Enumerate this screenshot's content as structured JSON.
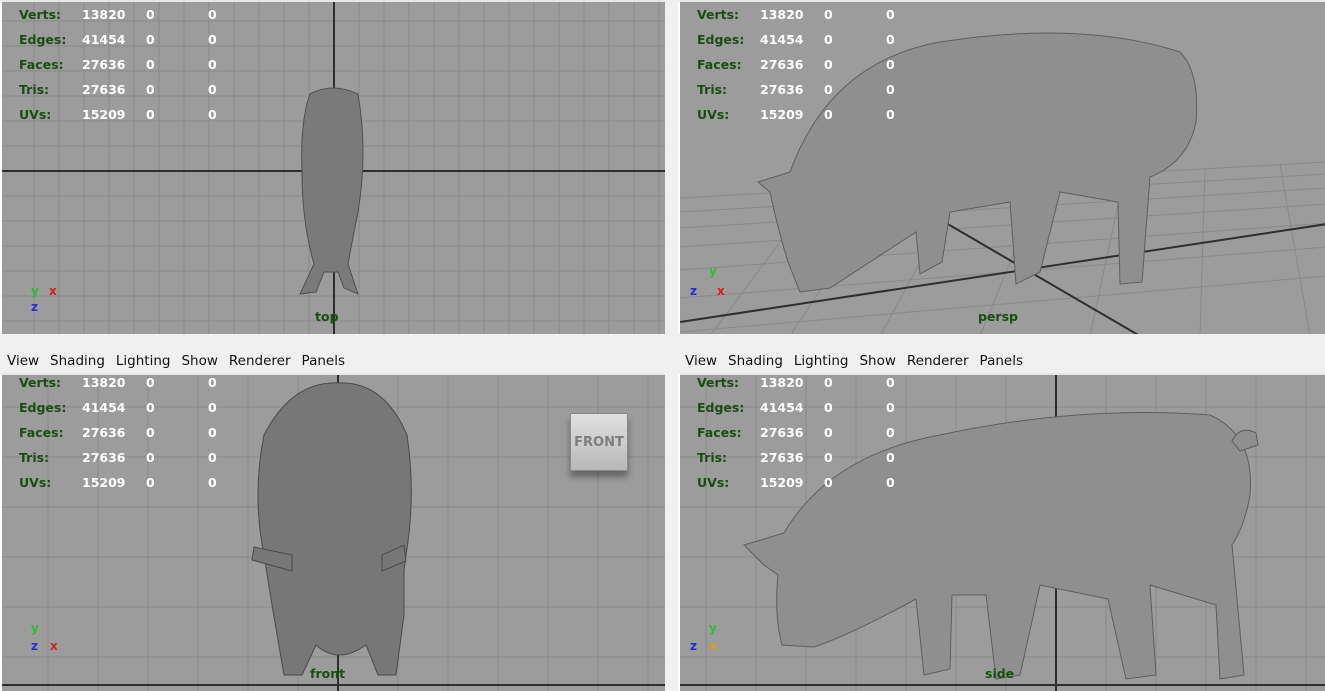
{
  "menu": [
    "View",
    "Shading",
    "Lighting",
    "Show",
    "Renderer",
    "Panels"
  ],
  "stats": [
    {
      "label": "Verts:",
      "v1": "13820",
      "v2": "0",
      "v3": "0"
    },
    {
      "label": "Edges:",
      "v1": "41454",
      "v2": "0",
      "v3": "0"
    },
    {
      "label": "Faces:",
      "v1": "27636",
      "v2": "0",
      "v3": "0"
    },
    {
      "label": "Tris:",
      "v1": "27636",
      "v2": "0",
      "v3": "0"
    },
    {
      "label": "UVs:",
      "v1": "15209",
      "v2": "0",
      "v3": "0"
    }
  ],
  "viewports": {
    "top": {
      "camera": "top",
      "axis_a": "y",
      "axis_b": "x",
      "axis_c": "z"
    },
    "persp": {
      "camera": "persp",
      "axis_a": "y",
      "axis_b": "x",
      "axis_c": "z"
    },
    "front": {
      "camera": "front",
      "axis_a": "y",
      "axis_b": "x",
      "axis_c": "z",
      "view_cube": "FRONT"
    },
    "side": {
      "camera": "side",
      "axis_a": "y",
      "axis_b": "x",
      "axis_c": "z"
    }
  },
  "colors": {
    "viewport_bg": "#9c9c9c",
    "hud_label": "#164f0e",
    "axis_x": "#d42020",
    "axis_y": "#2bbf2b",
    "axis_z": "#2a2ad6"
  },
  "icons": {
    "view_cube": "view-cube-icon",
    "axis_gizmo": "axis-gizmo-icon",
    "model": "pig-mesh"
  }
}
